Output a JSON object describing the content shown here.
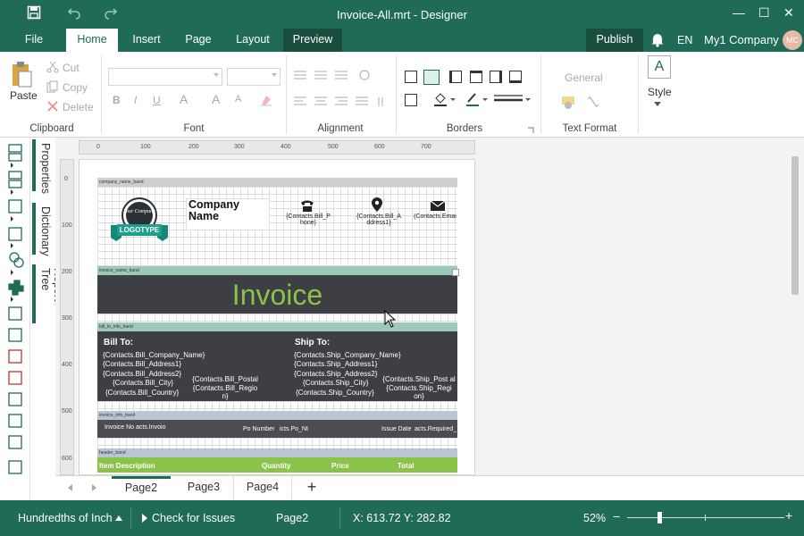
{
  "titlebar": {
    "title": "Invoice-All.mrt - Designer",
    "minimize": "—",
    "maximize": "☐",
    "close": "✕",
    "save_icon": "floppy-icon",
    "undo_icon": "undo-icon",
    "redo_icon": "redo-icon"
  },
  "tabs": {
    "file": "File",
    "home": "Home",
    "insert": "Insert",
    "page": "Page",
    "layout": "Layout",
    "preview": "Preview"
  },
  "header_right": {
    "publish": "Publish",
    "lang": "EN",
    "company": "My1 Company",
    "avatar": "MC"
  },
  "ribbon": {
    "clipboard": {
      "paste": "Paste",
      "cut": "Cut",
      "copy": "Copy",
      "delete": "Delete",
      "label": "Clipboard"
    },
    "font": {
      "label": "Font",
      "bold": "B",
      "italic": "I",
      "underline": "U",
      "font_color": "A",
      "grow": "A",
      "shrink": "A"
    },
    "alignment": {
      "label": "Alignment"
    },
    "borders": {
      "label": "Borders"
    },
    "text_format": {
      "label": "Text Format",
      "format": "General"
    },
    "style": {
      "label": "Style",
      "icon_text": "A"
    }
  },
  "side_panels": {
    "properties": "Properties",
    "dictionary": "Dictionary",
    "report_tree": "Report Tree"
  },
  "ruler": {
    "h": [
      "0",
      "100",
      "200",
      "300",
      "400",
      "500",
      "600",
      "700"
    ],
    "v": [
      "0",
      "100",
      "200",
      "300",
      "400",
      "500",
      "600"
    ]
  },
  "report": {
    "bands": {
      "company_name": "company_name_band",
      "invoice_name": "invoice_name_band",
      "bill_to_info": "bill_to_info_band",
      "invoice_info": "invoice_info_band",
      "header": "header_band"
    },
    "logo_text": "LOGOTYPE",
    "logo_inner": "Your Company",
    "company_name": "Company Name",
    "contact_phone": "{Contacts.Bill_P hone}",
    "contact_address": "{Contacts.Bill_A ddress1}",
    "contact_email": "{Contacts.Emai l}",
    "invoice_title": "Invoice",
    "bill_to": {
      "heading": "Bill To:",
      "lines": [
        "{Contacts.Bill_Company_Name}",
        "{Contacts.Bill_Address1}",
        "{Contacts.Bill_Address2}",
        "{Contacts.Bill_City}",
        "{Contacts.Bill_Country}"
      ],
      "postal": "{Contacts.Bill_Postal",
      "region": "{Contacts.Bill_Regio n}"
    },
    "ship_to": {
      "heading": "Ship To:",
      "lines": [
        "{Contacts.Ship_Company_Name}",
        "{Contacts.Ship_Address1}",
        "{Contacts.Ship_Address2}",
        "{Contacts.Ship_City}",
        "{Contacts.Ship_Country}"
      ],
      "postal": "{Contacts.Ship_Post al",
      "region": "{Contacts.Ship_Regi on}"
    },
    "invoice_info": {
      "invoice_no": "Invoice No",
      "invoice_val": "acts.Invoio",
      "po_number": "Po Number",
      "po_val": "icts.Po_Nt",
      "issue_date": "Issue Date",
      "issue_val": "acts.Required_"
    },
    "header_cols": [
      "Item Description",
      "Quantity",
      "Price",
      "Total"
    ]
  },
  "page_tabs": [
    "Page2",
    "Page3",
    "Page4"
  ],
  "page_tab_add": "+",
  "status": {
    "units": "Hundredths of Inch",
    "check": "Check for Issues",
    "page": "Page2",
    "coords": "X: 613.72 Y: 282.82",
    "zoom": "52%",
    "zoom_level": 0.52
  },
  "colors": {
    "accent": "#1f6b57",
    "invoice_green": "#8bc34a",
    "band_dark": "#3d3f44"
  }
}
